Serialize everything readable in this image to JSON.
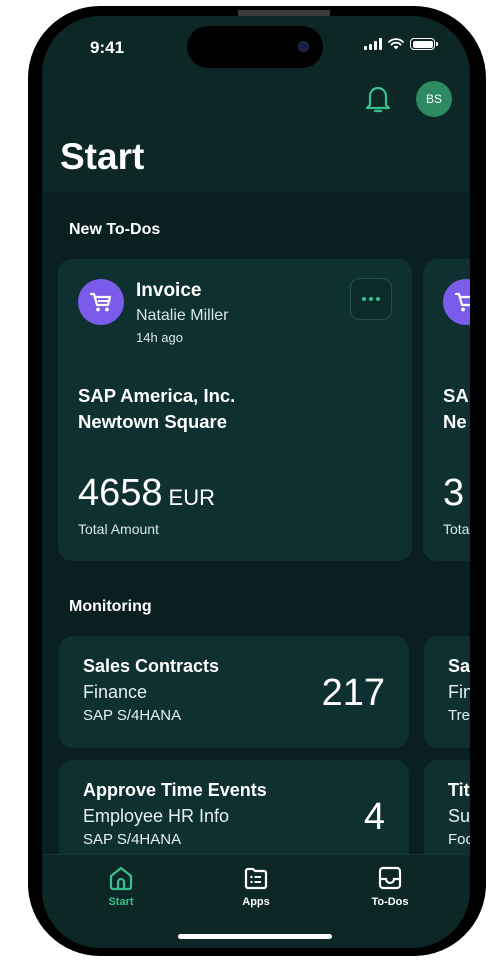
{
  "status": {
    "time": "9:41"
  },
  "header": {
    "avatar_initials": "BS",
    "title": "Start"
  },
  "todos": {
    "section_title": "New To-Dos",
    "card": {
      "title": "Invoice",
      "person": "Natalie Miller",
      "time": "14h ago",
      "company_line1": "SAP America, Inc.",
      "company_line2": "Newtown Square",
      "amount": "4658",
      "currency": "EUR",
      "amount_label": "Total Amount"
    },
    "peek": {
      "line1": "SA",
      "line2": "Ne",
      "amount": "3",
      "label": "Tota"
    }
  },
  "monitoring": {
    "section_title": "Monitoring",
    "cards": [
      {
        "title": "Sales Contracts",
        "subtitle": "Finance",
        "source": "SAP S/4HANA",
        "count": "217"
      },
      {
        "title": "Approve Time Events",
        "subtitle": "Employee HR Info",
        "source": "SAP S/4HANA",
        "count": "4"
      }
    ],
    "peek": [
      {
        "title": "Sa",
        "subtitle": "Fin",
        "source": "Tre"
      },
      {
        "title": "Tit",
        "subtitle": "Su",
        "source": "Foo"
      }
    ]
  },
  "tabs": [
    {
      "label": "Start",
      "icon": "home-icon",
      "active": true
    },
    {
      "label": "Apps",
      "icon": "apps-icon",
      "active": false
    },
    {
      "label": "To-Dos",
      "icon": "inbox-icon",
      "active": false
    }
  ],
  "colors": {
    "accent": "#36c28a",
    "avatar": "#2d8a63",
    "cart_badge": "#7b5bea",
    "background": "#0d2626"
  }
}
